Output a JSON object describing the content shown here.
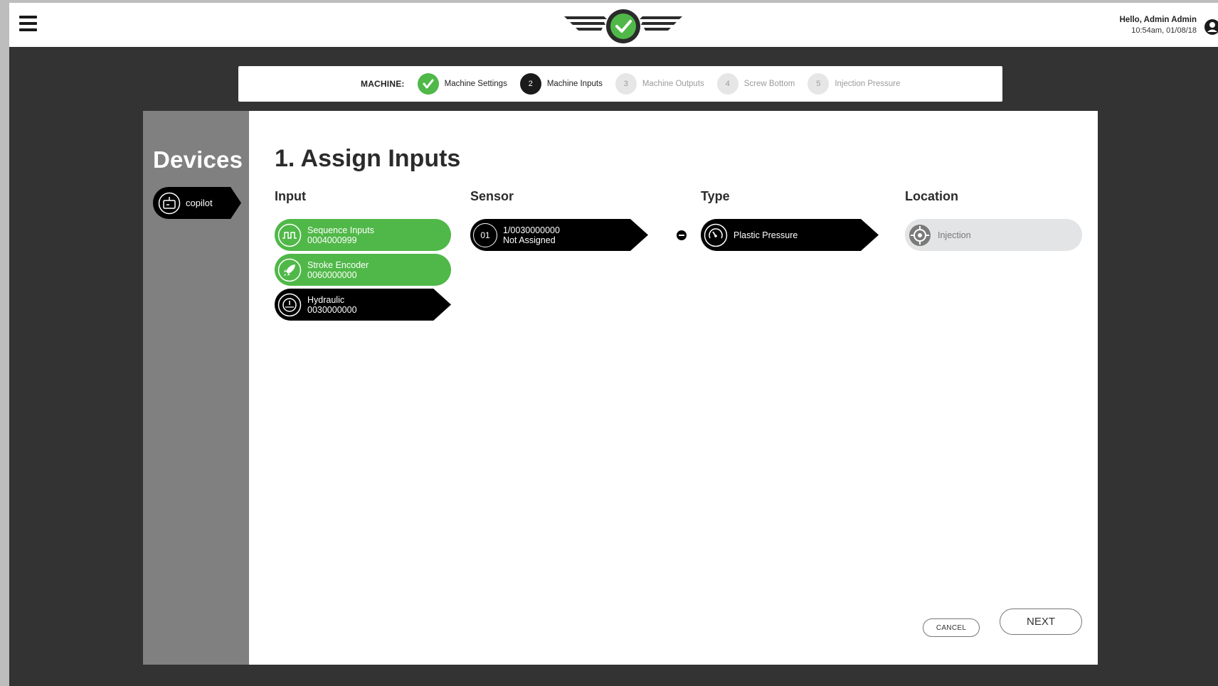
{
  "header": {
    "greeting": "Hello, Admin Admin",
    "datetime": "10:54am, 01/08/18",
    "menu_icon": "hamburger-menu-icon",
    "logo_icon": "winged-check-logo",
    "user_icon": "user-account-icon"
  },
  "stepper": {
    "label": "MACHINE:",
    "steps": [
      {
        "number": "",
        "label": "Machine Settings",
        "state": "done"
      },
      {
        "number": "2",
        "label": "Machine Inputs",
        "state": "active"
      },
      {
        "number": "3",
        "label": "Machine Outputs",
        "state": "pending"
      },
      {
        "number": "4",
        "label": "Screw Bottom",
        "state": "pending"
      },
      {
        "number": "5",
        "label": "Injection Pressure",
        "state": "pending"
      }
    ]
  },
  "sidebar": {
    "title": "Devices",
    "device": {
      "label": "copilot",
      "icon": "device-box-icon"
    }
  },
  "main": {
    "title": "1. Assign Inputs",
    "columns": {
      "input": "Input",
      "sensor": "Sensor",
      "type": "Type",
      "location": "Location"
    },
    "inputs": [
      {
        "name": "Sequence Inputs",
        "id": "0004000999",
        "icon": "square-wave-icon",
        "state": "assigned"
      },
      {
        "name": "Stroke Encoder",
        "id": "0060000000",
        "icon": "rocket-icon",
        "state": "assigned"
      },
      {
        "name": "Hydraulic",
        "id": "0030000000",
        "icon": "pressure-gauge-icon",
        "state": "selected"
      }
    ],
    "sensor": {
      "badge": "01",
      "line1": "1/0030000000",
      "line2": "Not Assigned"
    },
    "type": {
      "label": "Plastic Pressure",
      "icon": "gauge-icon"
    },
    "location": {
      "label": "Injection",
      "icon": "target-icon"
    },
    "buttons": {
      "cancel": "CANCEL",
      "next": "NEXT"
    }
  },
  "colors": {
    "green": "#50b848",
    "dark": "#333333",
    "sidebar": "#808080",
    "black": "#000000"
  }
}
